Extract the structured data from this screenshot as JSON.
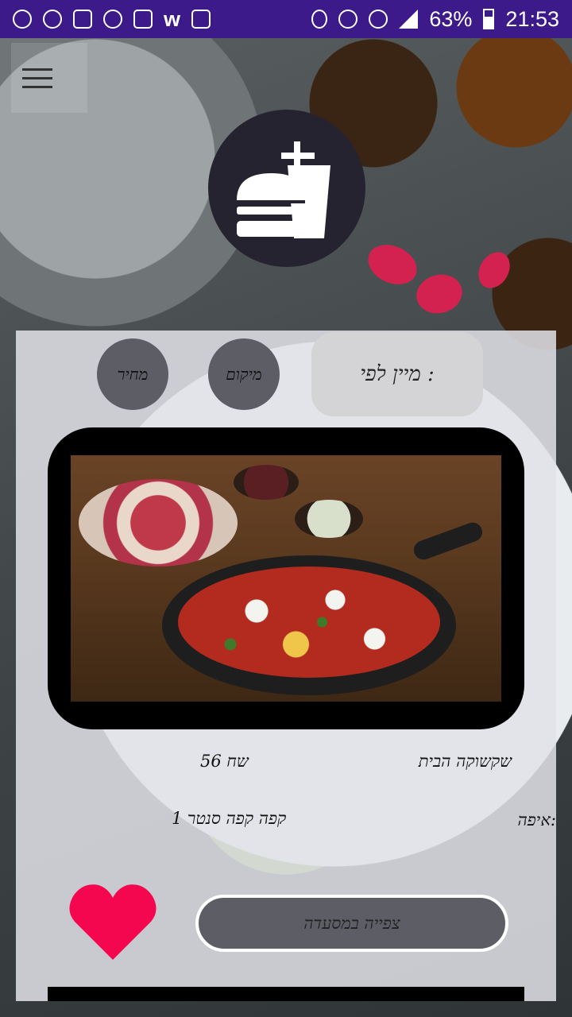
{
  "status_bar": {
    "battery_percent": "63%",
    "time": "21:53",
    "bg_color": "#3c1a8a"
  },
  "header": {
    "menu_icon": "hamburger-menu-icon",
    "logo_icon": "burger-drink-icon"
  },
  "sort": {
    "label": "מיין לפי :",
    "buttons": [
      {
        "label": "מיקום"
      },
      {
        "label": "מחיר"
      }
    ]
  },
  "dish": {
    "name": "שקשוקה הבית",
    "price": "56 שח",
    "location_label": "איפה:",
    "location_value": "קפה קפה סנטר 1",
    "view_button_label": "צפייה במסעדה",
    "favorite_icon": "heart-icon",
    "favorite_color": "#f5074f"
  }
}
